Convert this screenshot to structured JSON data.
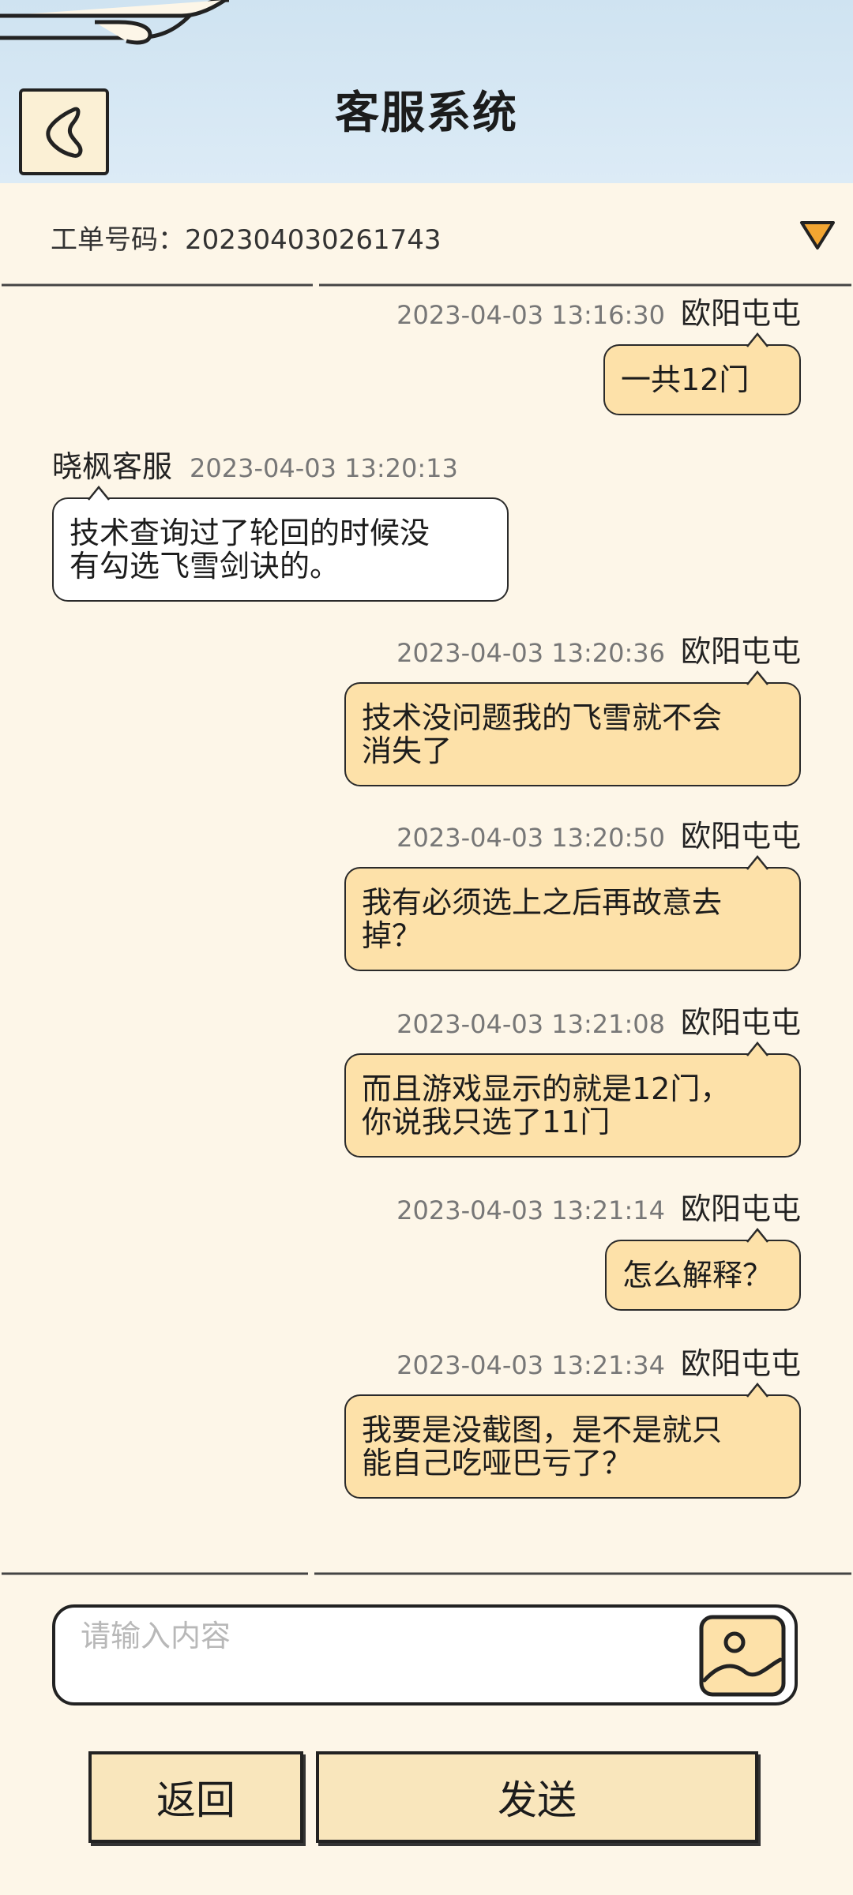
{
  "header": {
    "title": "客服系统",
    "back_icon": "chevron-left-icon"
  },
  "ticket": {
    "label": "工单号码：202304030261743",
    "toggle_icon": "triangle-down-icon"
  },
  "messages": [
    {
      "role": "user",
      "name": "欧阳屯屯",
      "time": "2023-04-03 13:16:30",
      "line1": "一共12门",
      "line2": ""
    },
    {
      "role": "agent",
      "name": "晓枫客服",
      "time": "2023-04-03 13:20:13",
      "line1": "技术查询过了轮回的时候没",
      "line2": "有勾选飞雪剑诀的。"
    },
    {
      "role": "user",
      "name": "欧阳屯屯",
      "time": "2023-04-03 13:20:36",
      "line1": "技术没问题我的飞雪就不会",
      "line2": "消失了"
    },
    {
      "role": "user",
      "name": "欧阳屯屯",
      "time": "2023-04-03 13:20:50",
      "line1": "我有必须选上之后再故意去",
      "line2": "掉？"
    },
    {
      "role": "user",
      "name": "欧阳屯屯",
      "time": "2023-04-03 13:21:08",
      "line1": "而且游戏显示的就是12门，",
      "line2": "你说我只选了11门"
    },
    {
      "role": "user",
      "name": "欧阳屯屯",
      "time": "2023-04-03 13:21:14",
      "line1": "怎么解释？",
      "line2": ""
    },
    {
      "role": "user",
      "name": "欧阳屯屯",
      "time": "2023-04-03 13:21:34",
      "line1": "我要是没截图，是不是就只",
      "line2": "能自己吃哑巴亏了？"
    }
  ],
  "composer": {
    "placeholder": "请输入内容",
    "value": "",
    "image_icon": "image-icon"
  },
  "buttons": {
    "back_label": "返回",
    "send_label": "发送"
  },
  "colors": {
    "header_bg": "#cfe3f1",
    "page_bg": "#fdf6e8",
    "user_bubble": "#fde1a9",
    "agent_bubble": "#ffffff",
    "button_bg": "#f9e6bc",
    "toggle_accent": "#f2a531"
  }
}
